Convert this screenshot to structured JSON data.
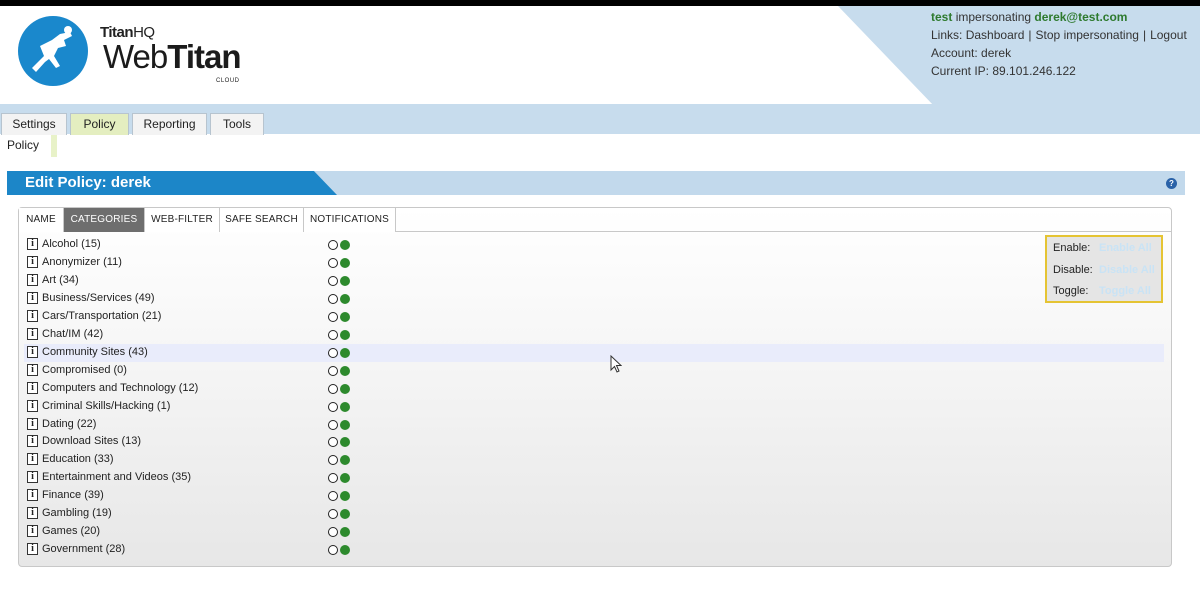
{
  "brand": {
    "titanhq_a": "Titan",
    "titanhq_b": "HQ",
    "product_a": "Web",
    "product_b": "Titan",
    "edition": "CLOUD",
    "logo_color": "#1a88cc"
  },
  "user_info": {
    "impersonator": "test",
    "impersonating_text": "impersonating",
    "impersonated": "derek@test.com",
    "links_label": "Links:",
    "links": [
      "Dashboard",
      "Stop impersonating",
      "Logout"
    ],
    "account_label": "Account:",
    "account": "derek",
    "ip_label": "Current IP:",
    "ip": "89.101.246.122"
  },
  "nav": {
    "tabs": [
      "Settings",
      "Policy",
      "Reporting",
      "Tools"
    ],
    "active_tab": "Policy",
    "subnav": "Policy"
  },
  "page": {
    "title": "Edit Policy: derek",
    "help_glyph": "?"
  },
  "policy_tabs": {
    "items": [
      "NAME",
      "CATEGORIES",
      "WEB-FILTER",
      "SAFE SEARCH",
      "NOTIFICATIONS"
    ],
    "active": "CATEGORIES"
  },
  "categories": [
    {
      "label": "Alcohol (15)",
      "state": "on"
    },
    {
      "label": "Anonymizer (11)",
      "state": "on"
    },
    {
      "label": "Art (34)",
      "state": "on"
    },
    {
      "label": "Business/Services (49)",
      "state": "on"
    },
    {
      "label": "Cars/Transportation (21)",
      "state": "on"
    },
    {
      "label": "Chat/IM (42)",
      "state": "on"
    },
    {
      "label": "Community Sites (43)",
      "state": "on",
      "highlighted": true
    },
    {
      "label": "Compromised (0)",
      "state": "on"
    },
    {
      "label": "Computers and Technology (12)",
      "state": "on"
    },
    {
      "label": "Criminal Skills/Hacking (1)",
      "state": "on"
    },
    {
      "label": "Dating (22)",
      "state": "on"
    },
    {
      "label": "Download Sites (13)",
      "state": "on"
    },
    {
      "label": "Education (33)",
      "state": "on"
    },
    {
      "label": "Entertainment and Videos (35)",
      "state": "on"
    },
    {
      "label": "Finance (39)",
      "state": "on"
    },
    {
      "label": "Gambling (19)",
      "state": "on"
    },
    {
      "label": "Games (20)",
      "state": "on"
    },
    {
      "label": "Government (28)",
      "state": "on"
    }
  ],
  "info_glyph": "i",
  "bulk_controls": {
    "enable_label": "Enable:",
    "enable_button": "Enable All",
    "disable_label": "Disable:",
    "disable_button": "Disable All",
    "toggle_label": "Toggle:",
    "toggle_button": "Toggle All"
  },
  "colors": {
    "accent_blue": "#1c86c8",
    "band_blue": "#c7dced",
    "active_tab": "#e4eec0",
    "enabled_green": "#2d8a2d",
    "control_border": "#e5c433"
  }
}
